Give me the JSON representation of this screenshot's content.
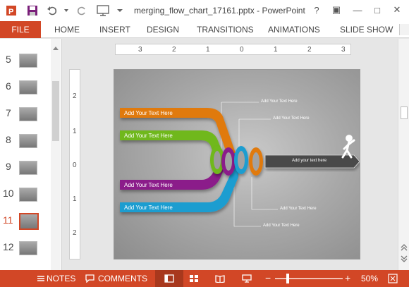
{
  "window": {
    "title": "merging_flow_chart_17161.pptx - PowerPoint",
    "controls": [
      "?",
      "▣",
      "—",
      "□",
      "✕"
    ]
  },
  "ribbon": {
    "file": "FILE",
    "tabs": [
      "HOME",
      "INSERT",
      "DESIGN",
      "TRANSITIONS",
      "ANIMATIONS",
      "SLIDE SHOW"
    ]
  },
  "slides_pane": {
    "numbers": [
      "5",
      "6",
      "7",
      "8",
      "9",
      "10",
      "11",
      "12"
    ],
    "selected": "11"
  },
  "ruler": {
    "horizontal": [
      "3",
      "2",
      "1",
      "0",
      "1",
      "2",
      "3"
    ],
    "vertical": [
      "2",
      "1",
      "0",
      "1",
      "2"
    ]
  },
  "slide": {
    "bars": [
      {
        "label": "Add Your Text Here",
        "color": "#e07a10"
      },
      {
        "label": "Add Your Text Here",
        "color": "#6fb81c"
      },
      {
        "label": "Add Your Text Here",
        "color": "#8b1c8a"
      },
      {
        "label": "Add Your Text Here",
        "color": "#1f9dd0"
      }
    ],
    "callouts": [
      "Add Your Text Here",
      "Add Your Text Here",
      "Add Your Text Here",
      "Add Your Text Here"
    ],
    "arrow_label": "Add your text here"
  },
  "status": {
    "notes": "NOTES",
    "comments": "COMMENTS",
    "zoom": "50%"
  },
  "colors": {
    "accent": "#d24726"
  }
}
